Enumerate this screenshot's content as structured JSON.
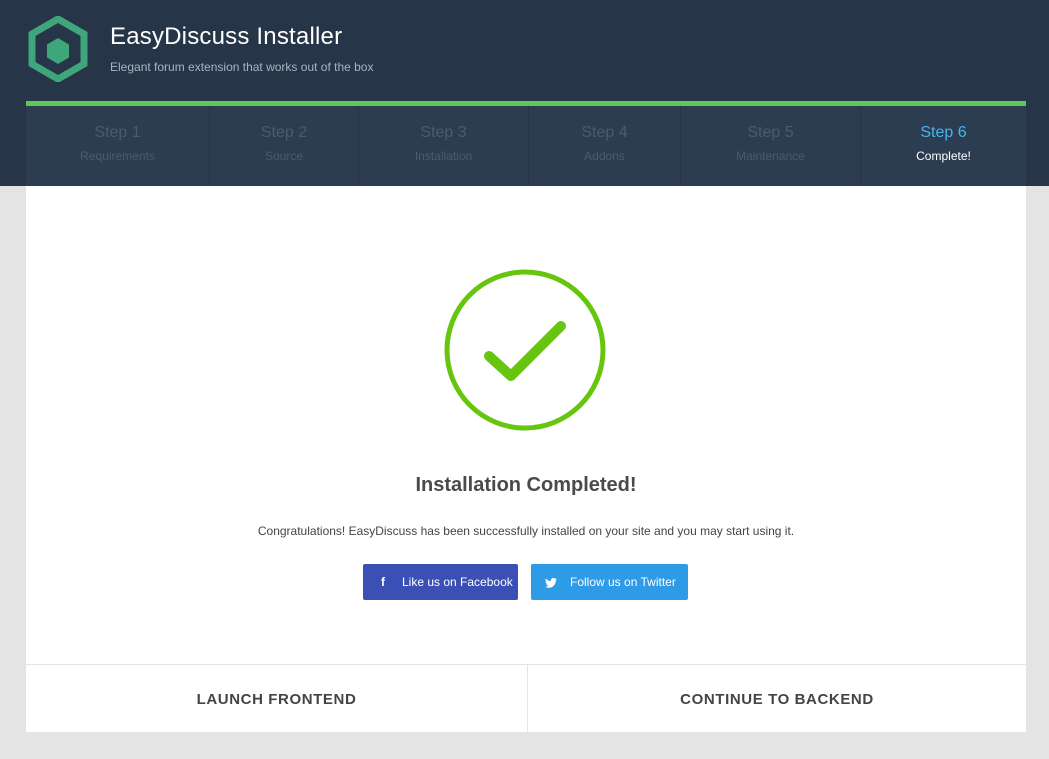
{
  "header": {
    "title": "EasyDiscuss Installer",
    "subtitle": "Elegant forum extension that works out of the box",
    "logo_icon": "hexagon-logo-icon",
    "accent_color": "#5ec95a"
  },
  "steps": [
    {
      "title": "Step 1",
      "label": "Requirements"
    },
    {
      "title": "Step 2",
      "label": "Source"
    },
    {
      "title": "Step 3",
      "label": "Installation"
    },
    {
      "title": "Step 4",
      "label": "Addons"
    },
    {
      "title": "Step 5",
      "label": "Maintenance"
    },
    {
      "title": "Step 6",
      "label": "Complete!"
    }
  ],
  "active_step": 6,
  "main": {
    "success_icon": "check-circle-icon",
    "success_color": "#66c50d",
    "heading": "Installation Completed!",
    "message": "Congratulations! EasyDiscuss has been successfully installed on your site and you may start using it.",
    "facebook": {
      "label": "Like us on Facebook",
      "icon": "facebook-icon",
      "color": "#3b50b5"
    },
    "twitter": {
      "label": "Follow us on Twitter",
      "icon": "twitter-icon",
      "color": "#2d9be6"
    }
  },
  "footer": {
    "launch_frontend": "LAUNCH FRONTEND",
    "continue_backend": "CONTINUE TO BACKEND"
  }
}
